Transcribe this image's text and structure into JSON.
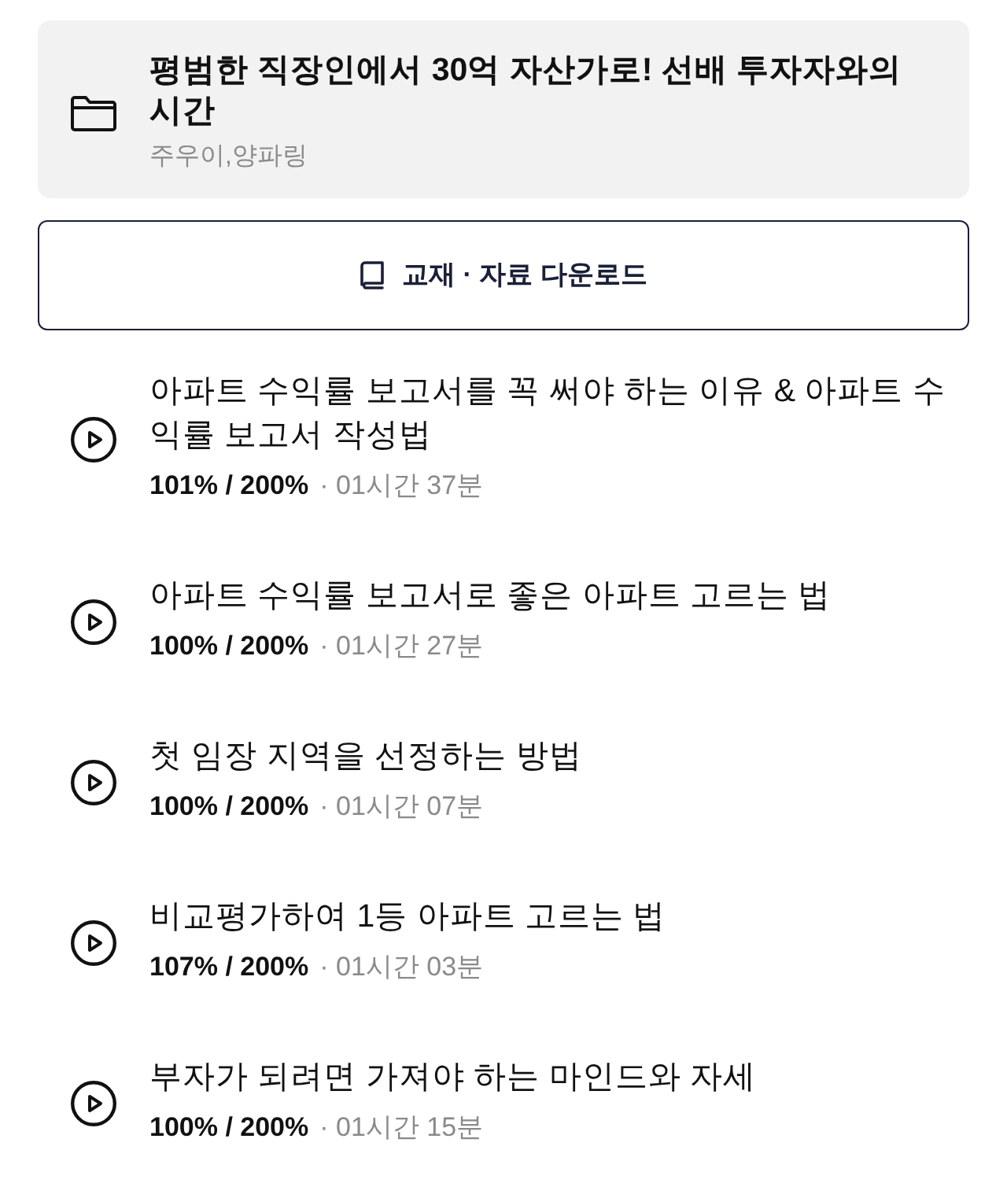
{
  "course": {
    "title": "평범한 직장인에서 30억 자산가로! 선배 투자자와의 시간",
    "instructors": "주우이,양파링"
  },
  "download_button": {
    "label": "교재 · 자료 다운로드"
  },
  "lectures": [
    {
      "title": "아파트 수익률 보고서를 꼭 써야 하는 이유 & 아파트 수익률 보고서 작성법",
      "progress": "101% / 200%",
      "duration": "· 01시간 37분"
    },
    {
      "title": "아파트 수익률 보고서로 좋은 아파트 고르는 법",
      "progress": "100% / 200%",
      "duration": "· 01시간 27분"
    },
    {
      "title": "첫 임장 지역을 선정하는 방법",
      "progress": "100% / 200%",
      "duration": "· 01시간 07분"
    },
    {
      "title": "비교평가하여 1등 아파트 고르는 법",
      "progress": "107% / 200%",
      "duration": "· 01시간 03분"
    },
    {
      "title": "부자가 되려면 가져야 하는 마인드와 자세",
      "progress": "100% / 200%",
      "duration": "· 01시간 15분"
    }
  ]
}
